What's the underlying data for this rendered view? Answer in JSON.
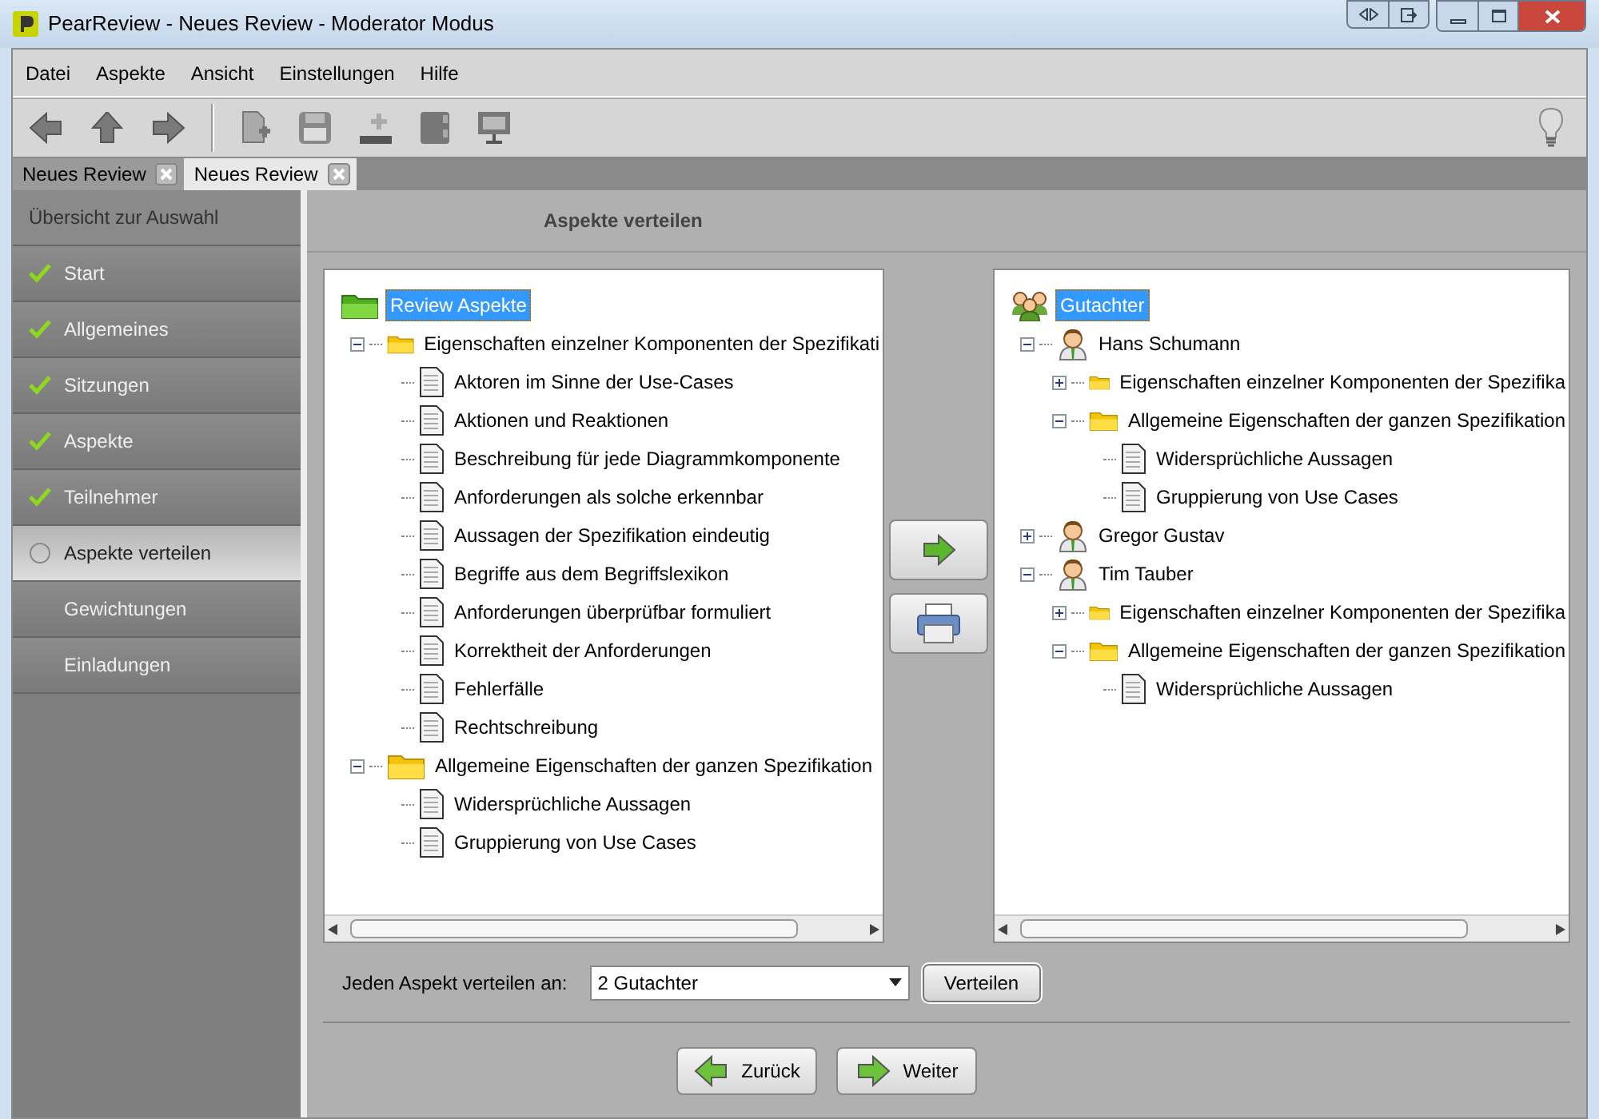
{
  "window": {
    "title": "PearReview - Neues Review - Moderator Modus"
  },
  "menu": [
    "Datei",
    "Aspekte",
    "Ansicht",
    "Einstellungen",
    "Hilfe"
  ],
  "tabs": [
    {
      "label": "Neues Review",
      "selected": false
    },
    {
      "label": "Neues Review",
      "selected": true
    }
  ],
  "sidebar": {
    "header": "Übersicht zur Auswahl",
    "items": [
      {
        "label": "Start",
        "kind": "done",
        "selected": false
      },
      {
        "label": "Allgemeines",
        "kind": "done",
        "selected": false
      },
      {
        "label": "Sitzungen",
        "kind": "done",
        "selected": false
      },
      {
        "label": "Aspekte",
        "kind": "done",
        "selected": false
      },
      {
        "label": "Teilnehmer",
        "kind": "done",
        "selected": false
      },
      {
        "label": "Aspekte verteilen",
        "kind": "current",
        "selected": true
      },
      {
        "label": "Gewichtungen",
        "kind": "pending",
        "selected": false
      },
      {
        "label": "Einladungen",
        "kind": "pending",
        "selected": false
      }
    ]
  },
  "panel": {
    "title": "Aspekte verteilen"
  },
  "left_tree": {
    "label": "Review Aspekte",
    "kind": "aspects",
    "selected": true,
    "children": [
      {
        "label": "Eigenschaften einzelner Komponenten der Spezifikati",
        "kind": "folder",
        "expanded": true,
        "children": [
          {
            "label": "Aktoren im Sinne der Use-Cases",
            "kind": "doc"
          },
          {
            "label": "Aktionen und Reaktionen",
            "kind": "doc"
          },
          {
            "label": "Beschreibung für jede Diagrammkomponente",
            "kind": "doc"
          },
          {
            "label": "Anforderungen als solche erkennbar",
            "kind": "doc"
          },
          {
            "label": "Aussagen der Spezifikation eindeutig",
            "kind": "doc"
          },
          {
            "label": "Begriffe aus dem Begriffslexikon",
            "kind": "doc"
          },
          {
            "label": "Anforderungen überprüfbar formuliert",
            "kind": "doc"
          },
          {
            "label": "Korrektheit der Anforderungen",
            "kind": "doc"
          },
          {
            "label": "Fehlerfälle",
            "kind": "doc"
          },
          {
            "label": "Rechtschreibung",
            "kind": "doc"
          }
        ]
      },
      {
        "label": "Allgemeine Eigenschaften der ganzen Spezifikation",
        "kind": "folder",
        "expanded": true,
        "children": [
          {
            "label": "Widersprüchliche Aussagen",
            "kind": "doc"
          },
          {
            "label": "Gruppierung von Use Cases",
            "kind": "doc"
          }
        ]
      }
    ]
  },
  "right_tree": {
    "label": "Gutachter",
    "kind": "group",
    "selected": true,
    "children": [
      {
        "label": "Hans Schumann",
        "kind": "person",
        "expanded": true,
        "children": [
          {
            "label": "Eigenschaften einzelner Komponenten der Spezifika",
            "kind": "folder",
            "expanded": false
          },
          {
            "label": "Allgemeine Eigenschaften der ganzen Spezifikation",
            "kind": "folder",
            "expanded": true,
            "children": [
              {
                "label": "Widersprüchliche Aussagen",
                "kind": "doc"
              },
              {
                "label": "Gruppierung von Use Cases",
                "kind": "doc"
              }
            ]
          }
        ]
      },
      {
        "label": "Gregor Gustav",
        "kind": "person",
        "expanded": false
      },
      {
        "label": "Tim Tauber",
        "kind": "person",
        "expanded": true,
        "children": [
          {
            "label": "Eigenschaften einzelner Komponenten der Spezifika",
            "kind": "folder",
            "expanded": false
          },
          {
            "label": "Allgemeine Eigenschaften der ganzen Spezifikation",
            "kind": "folder",
            "expanded": true,
            "children": [
              {
                "label": "Widersprüchliche Aussagen",
                "kind": "doc"
              }
            ]
          }
        ]
      }
    ]
  },
  "distribute": {
    "label": "Jeden Aspekt verteilen an:",
    "value": "2 Gutachter",
    "button": "Verteilen"
  },
  "nav": {
    "back": "Zurück",
    "next": "Weiter"
  }
}
